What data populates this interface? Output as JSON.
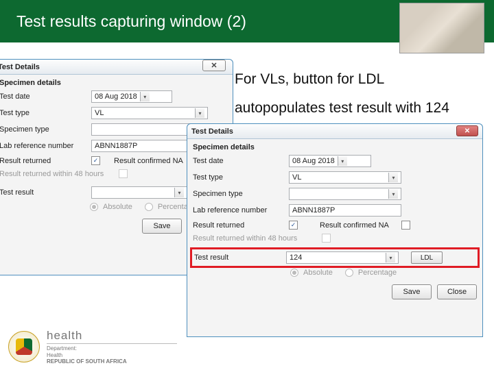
{
  "header": {
    "title": "Test results capturing window (2)"
  },
  "annotation": {
    "line1": "For VLs, button for LDL",
    "line2": "autopopulates test result with 124"
  },
  "winA": {
    "title": "Test Details",
    "section": "Specimen details",
    "labels": {
      "testDate": "Test date",
      "testType": "Test type",
      "specimenType": "Specimen type",
      "labRef": "Lab reference number",
      "resultReturned": "Result returned",
      "resultConfirmed": "Result confirmed NA",
      "within48": "Result returned within 48 hours",
      "testResult": "Test result",
      "absolute": "Absolute",
      "percentage": "Percentage",
      "ldl": "LDL",
      "save": "Save",
      "close": "Close"
    },
    "values": {
      "testDate": "08 Aug 2018",
      "testType": "VL",
      "specimenType": "",
      "labRef": "ABNN1887P",
      "resultReturnedChecked": "✓",
      "resultConfirmedChecked": "",
      "within48Checked": "",
      "testResult": ""
    }
  },
  "winB": {
    "title": "Test Details",
    "section": "Specimen details",
    "labels": {
      "testDate": "Test date",
      "testType": "Test type",
      "specimenType": "Specimen type",
      "labRef": "Lab reference number",
      "resultReturned": "Result returned",
      "resultConfirmed": "Result confirmed NA",
      "within48": "Result returned within 48 hours",
      "testResult": "Test result",
      "absolute": "Absolute",
      "percentage": "Percentage",
      "ldl": "LDL",
      "save": "Save",
      "close": "Close"
    },
    "values": {
      "testDate": "08 Aug 2018",
      "testType": "VL",
      "specimenType": "",
      "labRef": "ABNN1887P",
      "resultReturnedChecked": "✓",
      "resultConfirmedChecked": "",
      "within48Checked": "",
      "testResult": "124"
    }
  },
  "footer": {
    "brand": "health",
    "line1": "Department:",
    "line2": "Health",
    "line3": "REPUBLIC OF SOUTH AFRICA"
  }
}
